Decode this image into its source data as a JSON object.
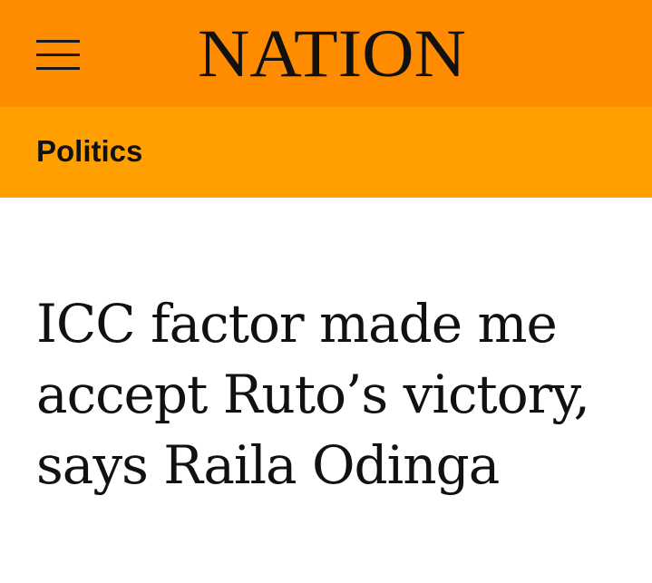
{
  "header": {
    "brand": "NATION",
    "menu_icon": "hamburger-menu-icon",
    "background_color": "#ff8c00"
  },
  "section": {
    "label": "Politics",
    "background_color": "#ffa000"
  },
  "article": {
    "headline": "ICC factor made me accept Ruto’s victory, says Raila Odinga"
  }
}
